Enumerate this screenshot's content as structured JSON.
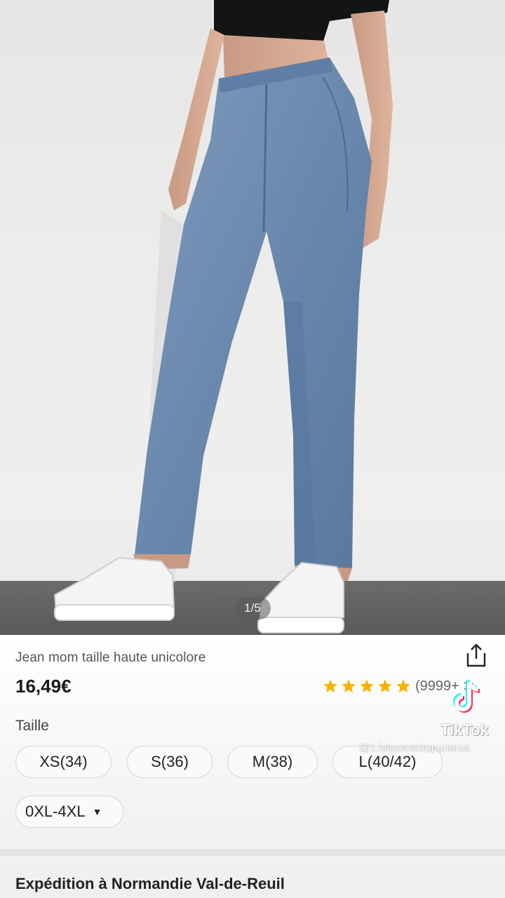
{
  "gallery": {
    "counter": "1/5"
  },
  "product": {
    "title": "Jean mom taille haute unicolore",
    "price": "16,49€",
    "rating": {
      "stars": 5,
      "count": "(9999+",
      "chevron": ">",
      "star_color": "#f5b400"
    }
  },
  "size": {
    "label": "Taille",
    "options": [
      "XS(34)",
      "S(36)",
      "M(38)",
      "L(40/42)"
    ],
    "extended_range": "0XL-4XL",
    "extended_caret": "▼"
  },
  "shipping": {
    "label": "Expédition à Normandie Val-de-Reuil"
  },
  "watermark": {
    "brand": "TikTok",
    "handle": "@1.laisseraistuportersa"
  },
  "icons": {
    "share": "share-icon",
    "star": "star-icon",
    "tiktok": "tiktok-logo-icon"
  }
}
